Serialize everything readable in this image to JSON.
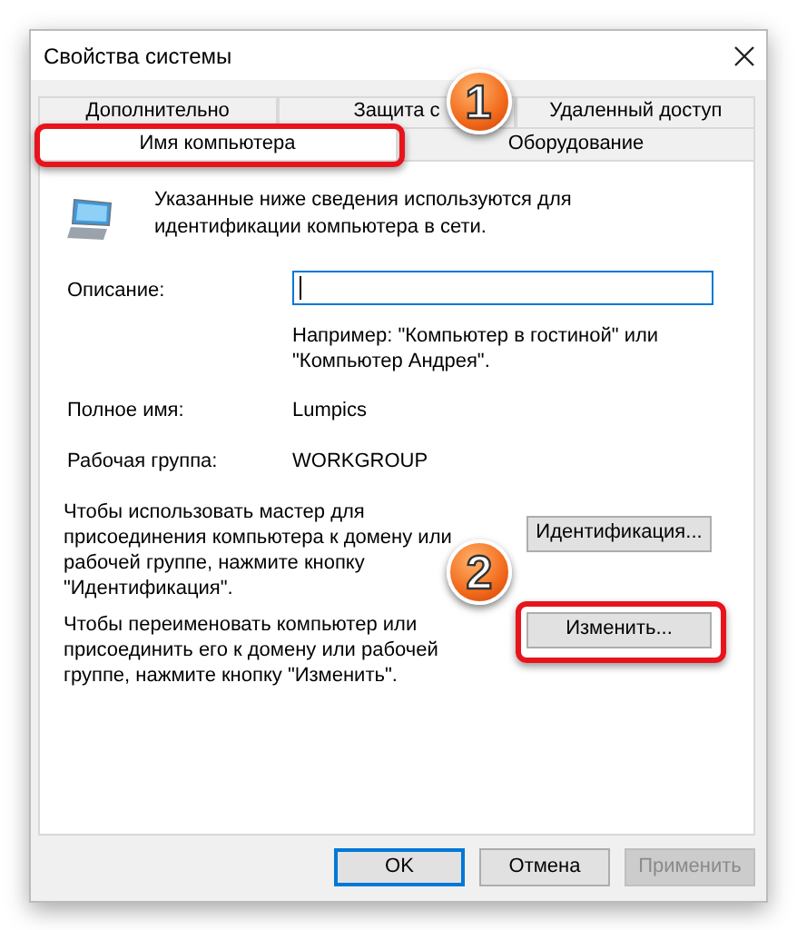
{
  "window": {
    "title": "Свойства системы"
  },
  "tab_rows": [
    [
      {
        "label": "Дополнительно",
        "selected": false,
        "highlighted": false
      },
      {
        "label": "Защита с",
        "selected": false,
        "highlighted": false
      },
      {
        "label": "Удаленный доступ",
        "selected": false,
        "highlighted": false
      }
    ],
    [
      {
        "label": "Имя компьютера",
        "selected": true,
        "highlighted": true,
        "callout": "1"
      },
      {
        "label": "Оборудование",
        "selected": false,
        "highlighted": false
      }
    ]
  ],
  "intro": "Указанные ниже сведения используются для идентификации компьютера в сети.",
  "description": {
    "label": "Описание:",
    "focused": true,
    "hint": "Например: \"Компьютер в гостиной\" или \"Компьютер Андрея\"."
  },
  "info": [
    {
      "label": "Полное имя:",
      "value": "Lumpics"
    },
    {
      "label": "Рабочая группа:",
      "value": "WORKGROUP"
    }
  ],
  "actions": [
    {
      "text": "Чтобы использовать мастер для присоединения компьютера к домену или рабочей группе, нажмите кнопку \"Идентификация\".",
      "button": "Идентификация...",
      "highlighted": false
    },
    {
      "text": "Чтобы переименовать компьютер или присоединить его к домену или рабочей группе, нажмите кнопку \"Изменить\".",
      "button": "Изменить...",
      "highlighted": true,
      "callout": "2"
    }
  ],
  "buttons": [
    {
      "label": "OK",
      "default": true,
      "disabled": false
    },
    {
      "label": "Отмена",
      "default": false,
      "disabled": false
    },
    {
      "label": "Применить",
      "default": false,
      "disabled": true
    }
  ]
}
